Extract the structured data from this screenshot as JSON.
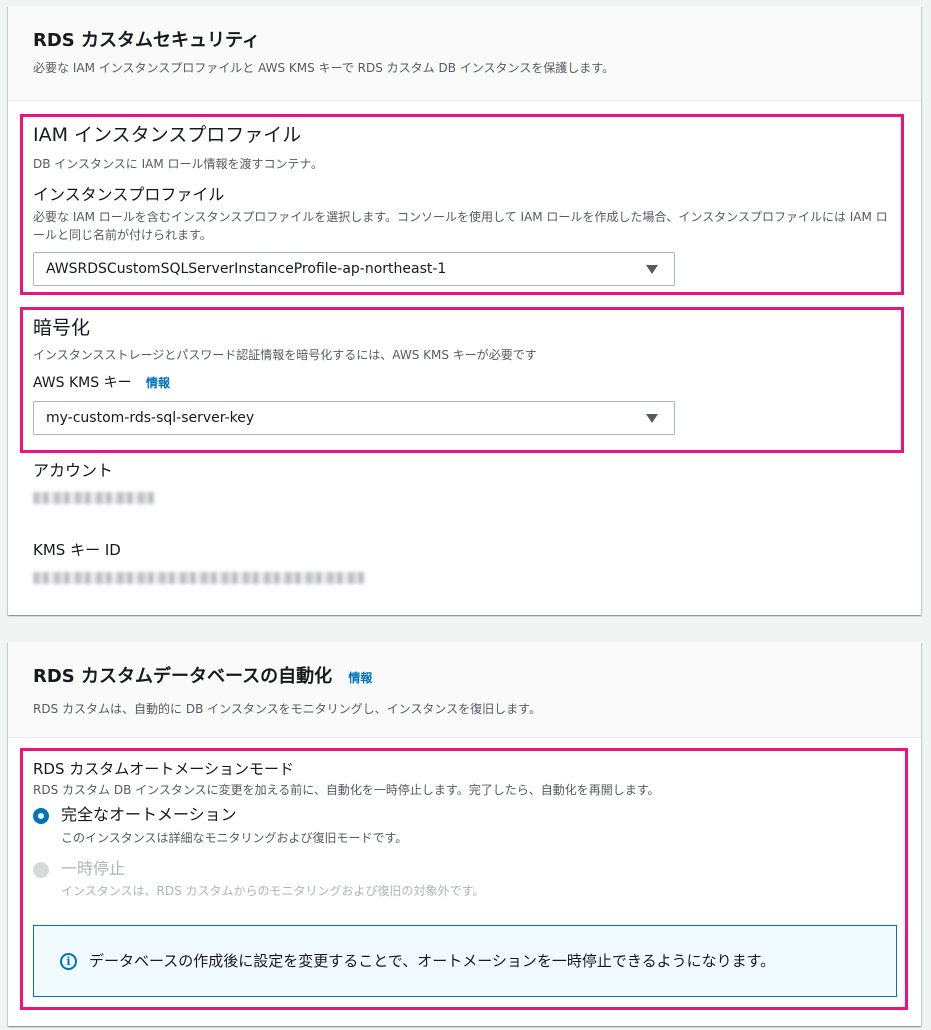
{
  "security": {
    "title": "RDS カスタムセキュリティ",
    "description": "必要な IAM インスタンスプロファイルと AWS KMS キーで RDS カスタム DB インスタンスを保護します。",
    "iam": {
      "heading": "IAM インスタンスプロファイル",
      "description": "DB インスタンスに IAM ロール情報を渡すコンテナ。",
      "field_label": "インスタンスプロファイル",
      "field_description": "必要な IAM ロールを含むインスタンスプロファイルを選択します。コンソールを使用して IAM ロールを作成した場合、インスタンスプロファイルには IAM ロールと同じ名前が付けられます。",
      "selected_value": "AWSRDSCustomSQLServerInstanceProfile-ap-northeast-1"
    },
    "encryption": {
      "heading": "暗号化",
      "description": "インスタンスストレージとパスワード認証情報を暗号化するには、AWS KMS キーが必要です",
      "kms_label": "AWS KMS キー",
      "info_link": "情報",
      "selected_value": "my-custom-rds-sql-server-key"
    },
    "account_label": "アカウント",
    "kms_key_id_label": "KMS キー ID"
  },
  "automation": {
    "title": "RDS カスタムデータベースの自動化",
    "info_link": "情報",
    "description": "RDS カスタムは、自動的に DB インスタンスをモニタリングし、インスタンスを復旧します。",
    "mode_label": "RDS カスタムオートメーションモード",
    "mode_description": "RDS カスタム DB インスタンスに変更を加える前に、自動化を一時停止します。完了したら、自動化を再開します。",
    "options": [
      {
        "label": "完全なオートメーション",
        "description": "このインスタンスは詳細なモニタリングおよび復旧モードです。",
        "selected": true
      },
      {
        "label": "一時停止",
        "description": "インスタンスは、RDS カスタムからのモニタリングおよび復旧の対象外です。",
        "selected": false
      }
    ],
    "alert_text": "データベースの作成後に設定を変更することで、オートメーションを一時停止できるようになります。",
    "alert_icon": "info-circle-icon"
  },
  "colors": {
    "highlight": "#e8157c",
    "link": "#0073bb",
    "alert_bg": "#f1faff"
  }
}
